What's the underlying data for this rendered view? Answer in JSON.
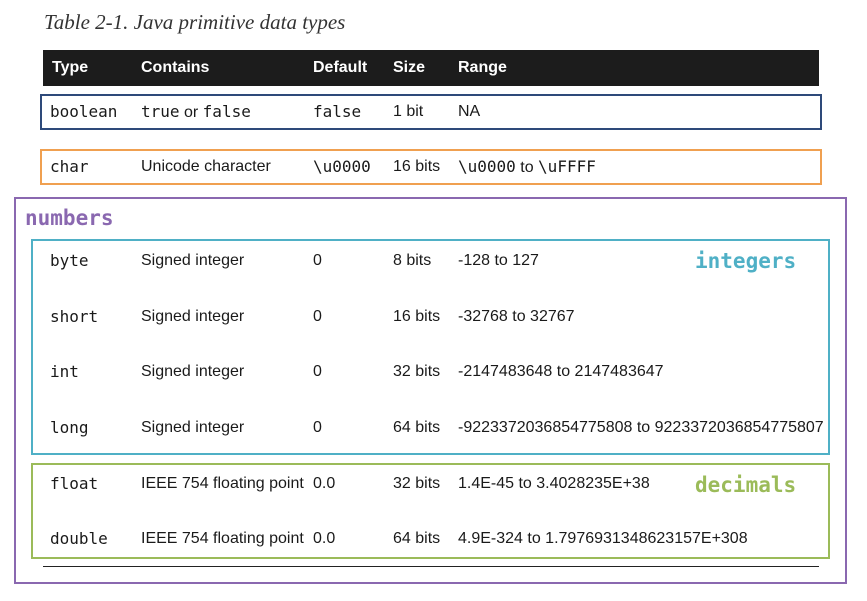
{
  "caption": "Table 2-1. Java primitive data types",
  "headers": [
    "Type",
    "Contains",
    "Default",
    "Size",
    "Range"
  ],
  "rows": [
    {
      "type": "boolean",
      "contains_a": "true",
      "contains_or": "or",
      "contains_b": "false",
      "default": "false",
      "size": "1 bit",
      "range": "NA"
    },
    {
      "type": "char",
      "contains": "Unicode character",
      "default": "\\u0000",
      "size": "16 bits",
      "range_a": "\\u0000",
      "range_to": "to",
      "range_b": "\\uFFFF"
    },
    {
      "type": "byte",
      "contains": "Signed integer",
      "default": "0",
      "size": "8 bits",
      "range": "-128 to 127"
    },
    {
      "type": "short",
      "contains": "Signed integer",
      "default": "0",
      "size": "16 bits",
      "range": "-32768 to 32767"
    },
    {
      "type": "int",
      "contains": "Signed integer",
      "default": "0",
      "size": "32 bits",
      "range": "-2147483648 to 2147483647"
    },
    {
      "type": "long",
      "contains": "Signed integer",
      "default": "0",
      "size": "64 bits",
      "range": "-9223372036854775808 to 9223372036854775807"
    },
    {
      "type": "float",
      "contains": "IEEE 754 floating point",
      "default": "0.0",
      "size": "32 bits",
      "range": "1.4E-45 to 3.4028235E+38"
    },
    {
      "type": "double",
      "contains": "IEEE 754 floating point",
      "default": "0.0",
      "size": "64 bits",
      "range": "4.9E-324 to 1.7976931348623157E+308"
    }
  ],
  "annotations": {
    "numbers": "numbers",
    "integers": "integers",
    "decimals": "decimals"
  },
  "colors": {
    "boolean_box": "#2e4a7a",
    "char_box": "#f0a050",
    "numbers_box": "#8a68b0",
    "integers_box": "#4fb0c6",
    "decimals_box": "#9bbb59"
  }
}
